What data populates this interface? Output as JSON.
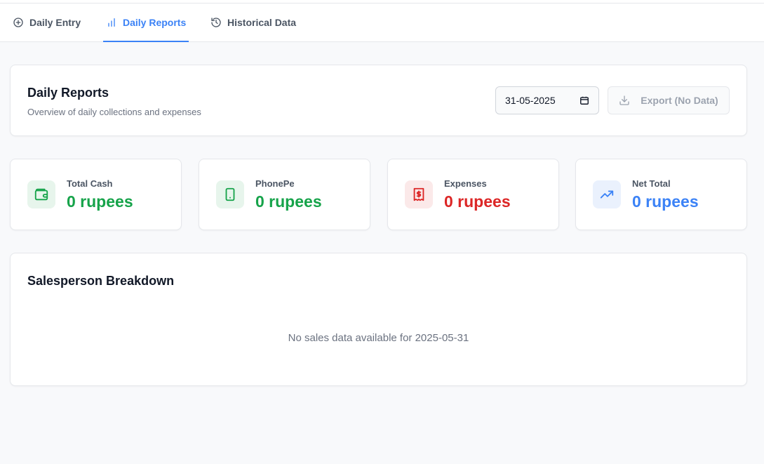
{
  "tabs": [
    {
      "label": "Daily Entry",
      "icon": "plus-circle-icon",
      "active": false
    },
    {
      "label": "Daily Reports",
      "icon": "bar-chart-icon",
      "active": true
    },
    {
      "label": "Historical Data",
      "icon": "history-icon",
      "active": false
    }
  ],
  "header": {
    "title": "Daily Reports",
    "subtitle": "Overview of daily collections and expenses",
    "date_value": "31-05-2025",
    "export_label": "Export (No Data)"
  },
  "stats": [
    {
      "label": "Total Cash",
      "value": "0 rupees",
      "icon": "wallet-icon",
      "color": "#16a34a",
      "bg": "#e7f5ec"
    },
    {
      "label": "PhonePe",
      "value": "0 rupees",
      "icon": "smartphone-icon",
      "color": "#16a34a",
      "bg": "#e7f5ec"
    },
    {
      "label": "Expenses",
      "value": "0 rupees",
      "icon": "receipt-icon",
      "color": "#dc2626",
      "bg": "#fbe9e9"
    },
    {
      "label": "Net Total",
      "value": "0 rupees",
      "icon": "trending-up-icon",
      "color": "#3b82f6",
      "bg": "#eaf1fd"
    }
  ],
  "breakdown": {
    "title": "Salesperson Breakdown",
    "empty_message": "No sales data available for 2025-05-31"
  },
  "colors": {
    "accent": "#3b82f6",
    "positive": "#16a34a",
    "negative": "#dc2626"
  }
}
